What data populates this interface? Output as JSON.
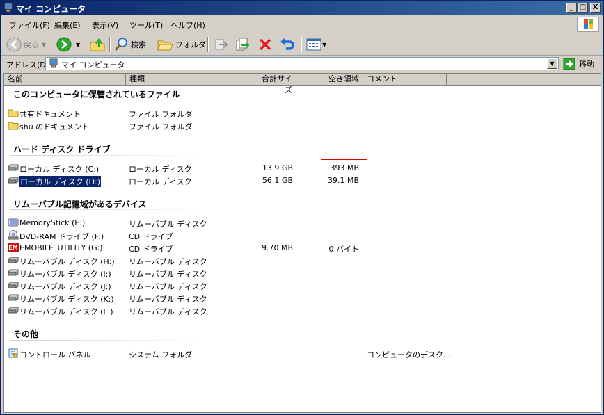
{
  "window": {
    "title": "マイ コンピュータ",
    "controls": {
      "minimize": "_",
      "maximize": "□",
      "close": "X"
    }
  },
  "menu": [
    "ファイル(F)",
    "編集(E)",
    "表示(V)",
    "ツール(T)",
    "ヘルプ(H)"
  ],
  "toolbar": {
    "back": "戻る",
    "search": "検索",
    "folders": "フォルダ"
  },
  "address": {
    "label": "アドレス(D)",
    "value": "マイ コンピュータ",
    "go": "移動"
  },
  "columns": [
    "名前",
    "種類",
    "合計サイズ",
    "空き領域",
    "コメント"
  ],
  "groups": {
    "stored": {
      "title": "このコンピュータに保管されているファイル",
      "items": [
        {
          "name": "共有ドキュメント",
          "type": "ファイル フォルダ",
          "total": "",
          "free": "",
          "comment": ""
        },
        {
          "name": "shu のドキュメント",
          "type": "ファイル フォルダ",
          "total": "",
          "free": "",
          "comment": ""
        }
      ]
    },
    "hdd": {
      "title": "ハード ディスク ドライブ",
      "items": [
        {
          "name": "ローカル ディスク (C:)",
          "type": "ローカル ディスク",
          "total": "13.9 GB",
          "free": "393 MB",
          "comment": ""
        },
        {
          "name": "ローカル ディスク (D:)",
          "type": "ローカル ディスク",
          "total": "56.1 GB",
          "free": "39.1 MB",
          "comment": ""
        }
      ]
    },
    "removable": {
      "title": "リムーバブル記憶域があるデバイス",
      "items": [
        {
          "name": "MemoryStick (E:)",
          "type": "リムーバブル ディスク",
          "total": "",
          "free": "",
          "comment": ""
        },
        {
          "name": "DVD-RAM ドライブ (F:)",
          "type": "CD ドライブ",
          "total": "",
          "free": "",
          "comment": ""
        },
        {
          "name": "EMOBILE_UTILITY (G:)",
          "type": "CD ドライブ",
          "total": "9.70 MB",
          "free": "0 バイト",
          "comment": ""
        },
        {
          "name": "リムーバブル ディスク (H:)",
          "type": "リムーバブル ディスク",
          "total": "",
          "free": "",
          "comment": ""
        },
        {
          "name": "リムーバブル ディスク (I:)",
          "type": "リムーバブル ディスク",
          "total": "",
          "free": "",
          "comment": ""
        },
        {
          "name": "リムーバブル ディスク (J:)",
          "type": "リムーバブル ディスク",
          "total": "",
          "free": "",
          "comment": ""
        },
        {
          "name": "リムーバブル ディスク (K:)",
          "type": "リムーバブル ディスク",
          "total": "",
          "free": "",
          "comment": ""
        },
        {
          "name": "リムーバブル ディスク (L:)",
          "type": "リムーバブル ディスク",
          "total": "",
          "free": "",
          "comment": ""
        }
      ]
    },
    "other": {
      "title": "その他",
      "items": [
        {
          "name": "コントロール パネル",
          "type": "システム フォルダ",
          "total": "",
          "free": "",
          "comment": "コンピュータのデスク..."
        }
      ]
    }
  },
  "colors": {
    "title_bar": "#0a246a",
    "selection": "#0a246a",
    "highlight_box": "#e00000"
  }
}
